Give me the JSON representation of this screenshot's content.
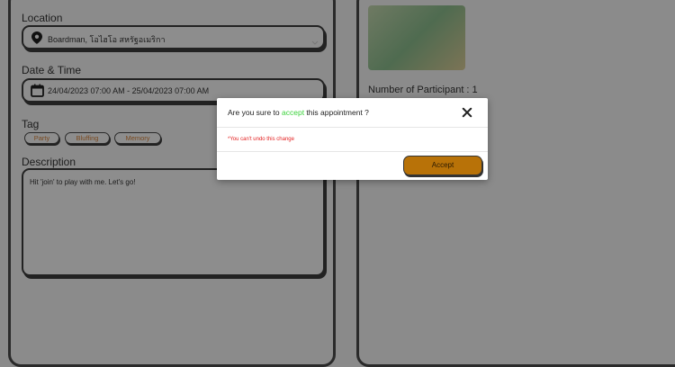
{
  "form": {
    "location_label": "Location",
    "location_value": "Boardman, โอไฮโอ สหรัฐอเมริกา",
    "datetime_label": "Date & Time",
    "datetime_value": "24/04/2023 07:00 AM - 25/04/2023 07:00 AM",
    "tag_label": "Tag",
    "tags": [
      "Party",
      "Bluffing",
      "Memory"
    ],
    "description_label": "Description",
    "description_value": "Hit 'join' to play with me. Let's go!"
  },
  "details": {
    "participants_text": "Number of Participant : 1"
  },
  "modal": {
    "title_before": "Are you sure to ",
    "title_accent": "accept",
    "title_after": " this appointment ?",
    "warning": "*You can't undo this change",
    "accept_label": "Accept"
  },
  "colors": {
    "overlay_bg": "#8a8a8a",
    "accent_green": "#3cd23c",
    "warning_red": "#e32020",
    "button_brown": "#b87208"
  },
  "icons": [
    "location-pin-icon",
    "chevron-down-icon",
    "calendar-icon",
    "close-icon"
  ]
}
